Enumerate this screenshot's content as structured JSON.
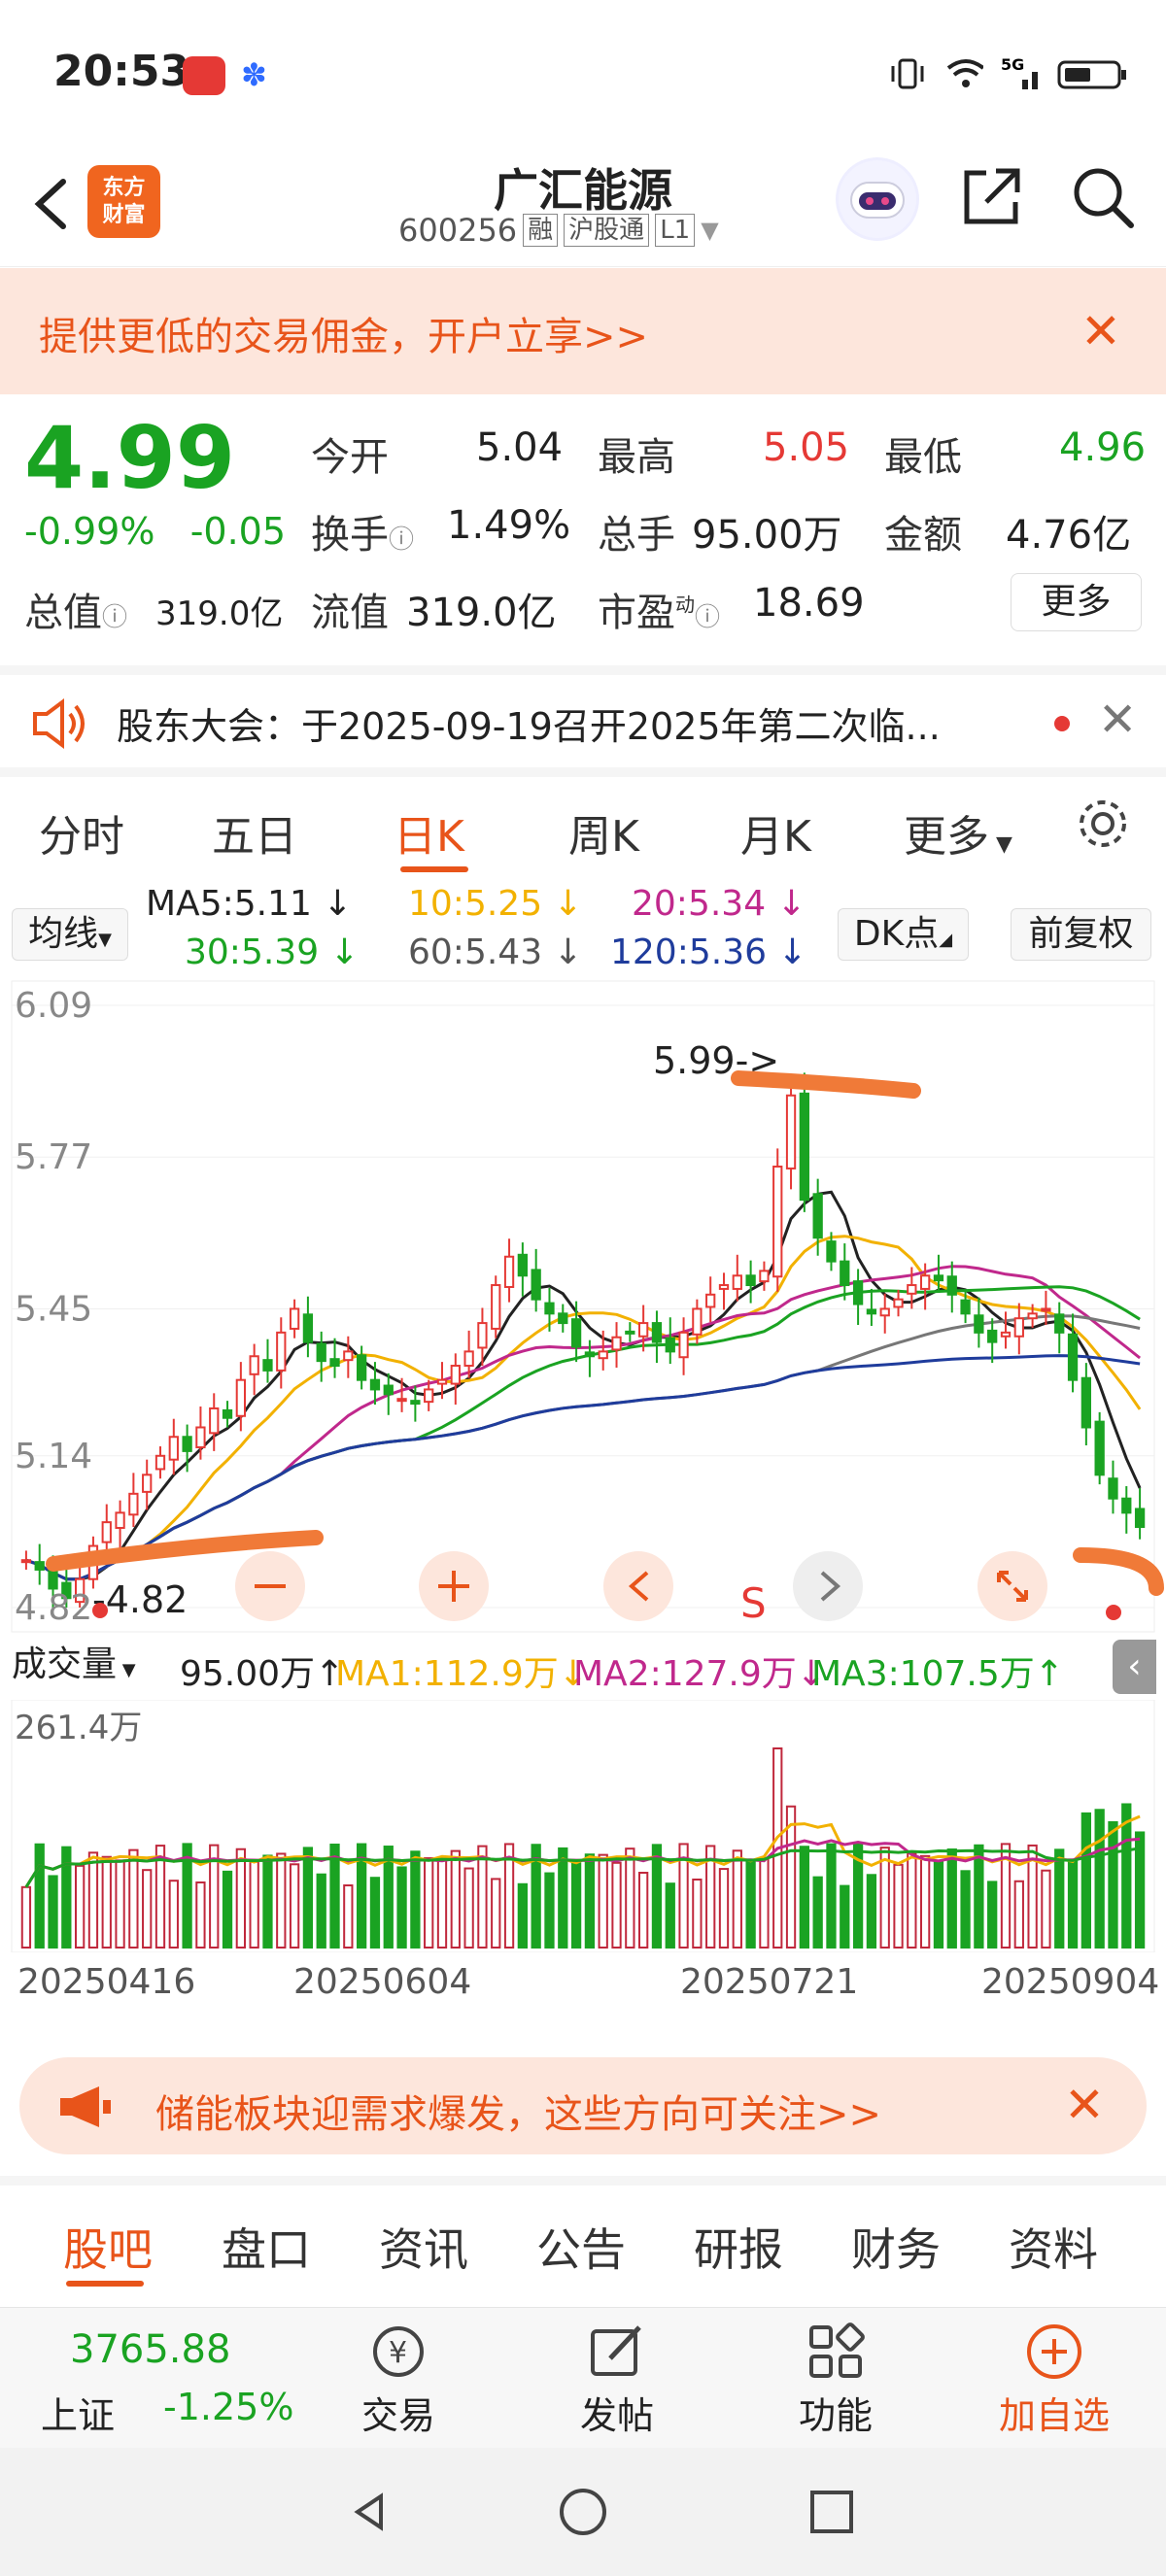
{
  "status": {
    "time": "20:53"
  },
  "header": {
    "title": "广汇能源",
    "code": "600256",
    "tags": [
      "融",
      "沪股通",
      "L1"
    ],
    "logo_line1": "东方",
    "logo_line2": "财富"
  },
  "promo": {
    "text": "提供更低的交易佣金，开户立享>>"
  },
  "quote": {
    "price": "4.99",
    "change_pct": "-0.99%",
    "change": "-0.05",
    "fields": {
      "open_label": "今开",
      "open": "5.04",
      "high_label": "最高",
      "high": "5.05",
      "low_label": "最低",
      "low": "4.96",
      "turnover_label": "换手",
      "turnover": "1.49%",
      "volume_label": "总手",
      "volume": "95.00万",
      "amount_label": "金额",
      "amount": "4.76亿",
      "mktcap_label": "总值",
      "mktcap": "319.0亿",
      "float_label": "流值",
      "float": "319.0亿",
      "pe_label": "市盈",
      "pe_sup": "动",
      "pe": "18.69"
    },
    "more_label": "更多"
  },
  "notice": {
    "text": "股东大会：于2025-09-19召开2025年第二次临..."
  },
  "period_tabs": [
    "分时",
    "五日",
    "日K",
    "周K",
    "月K",
    "更多"
  ],
  "ma_legend": {
    "selector": "均线",
    "ma5": "MA5:5.11",
    "ma10": "10:5.25",
    "ma20": "20:5.34",
    "ma30": "30:5.39",
    "ma60": "60:5.43",
    "ma120": "120:5.36",
    "dk": "DK点",
    "fuquan": "前复权"
  },
  "chart": {
    "y_ticks": [
      "6.09",
      "5.77",
      "5.45",
      "5.14",
      "4.82"
    ],
    "high_label": "5.99->",
    "low_label": "-4.82",
    "signal": "S"
  },
  "volume": {
    "selector": "成交量",
    "current": "95.00万",
    "ma1": "MA1:112.9万",
    "ma2": "MA2:127.9万",
    "ma3": "MA3:107.5万",
    "max_tick": "261.4万"
  },
  "dates": [
    "20250416",
    "20250604",
    "20250721",
    "20250904"
  ],
  "banner2": {
    "text": "储能板块迎需求爆发，这些方向可关注>>"
  },
  "bottom_tabs": [
    "股吧",
    "盘口",
    "资讯",
    "公告",
    "研报",
    "财务",
    "资料"
  ],
  "dock": {
    "index_value": "3765.88",
    "index_name": "上证",
    "index_change": "-1.25%",
    "items": [
      "交易",
      "发帖",
      "功能",
      "加自选"
    ]
  },
  "chart_data": {
    "type": "candlestick",
    "title": "广汇能源 日K",
    "ylim": [
      4.82,
      6.09
    ],
    "x_start": "20250416",
    "x_end": "20250904",
    "y_ticks": [
      6.09,
      5.77,
      5.45,
      5.14,
      4.82
    ],
    "period_high": 5.99,
    "period_low": 4.82,
    "last_close": 4.99,
    "ma_values": {
      "MA5": 5.11,
      "MA10": 5.25,
      "MA20": 5.34,
      "MA30": 5.39,
      "MA60": 5.43,
      "MA120": 5.36
    },
    "close_series": [
      4.92,
      4.9,
      4.86,
      4.84,
      4.88,
      4.95,
      5.0,
      5.02,
      5.06,
      5.1,
      5.14,
      5.18,
      5.15,
      5.2,
      5.24,
      5.22,
      5.3,
      5.35,
      5.32,
      5.4,
      5.45,
      5.38,
      5.34,
      5.33,
      5.36,
      5.3,
      5.28,
      5.27,
      5.26,
      5.25,
      5.28,
      5.3,
      5.33,
      5.36,
      5.42,
      5.5,
      5.56,
      5.52,
      5.47,
      5.44,
      5.42,
      5.37,
      5.35,
      5.36,
      5.39,
      5.4,
      5.42,
      5.38,
      5.36,
      5.4,
      5.45,
      5.48,
      5.5,
      5.52,
      5.5,
      5.53,
      5.75,
      5.9,
      5.68,
      5.6,
      5.55,
      5.5,
      5.46,
      5.44,
      5.45,
      5.47,
      5.5,
      5.52,
      5.51,
      5.48,
      5.44,
      5.4,
      5.38,
      5.4,
      5.43,
      5.44,
      5.45,
      5.4,
      5.3,
      5.2,
      5.1,
      5.05,
      5.02,
      4.99
    ]
  }
}
